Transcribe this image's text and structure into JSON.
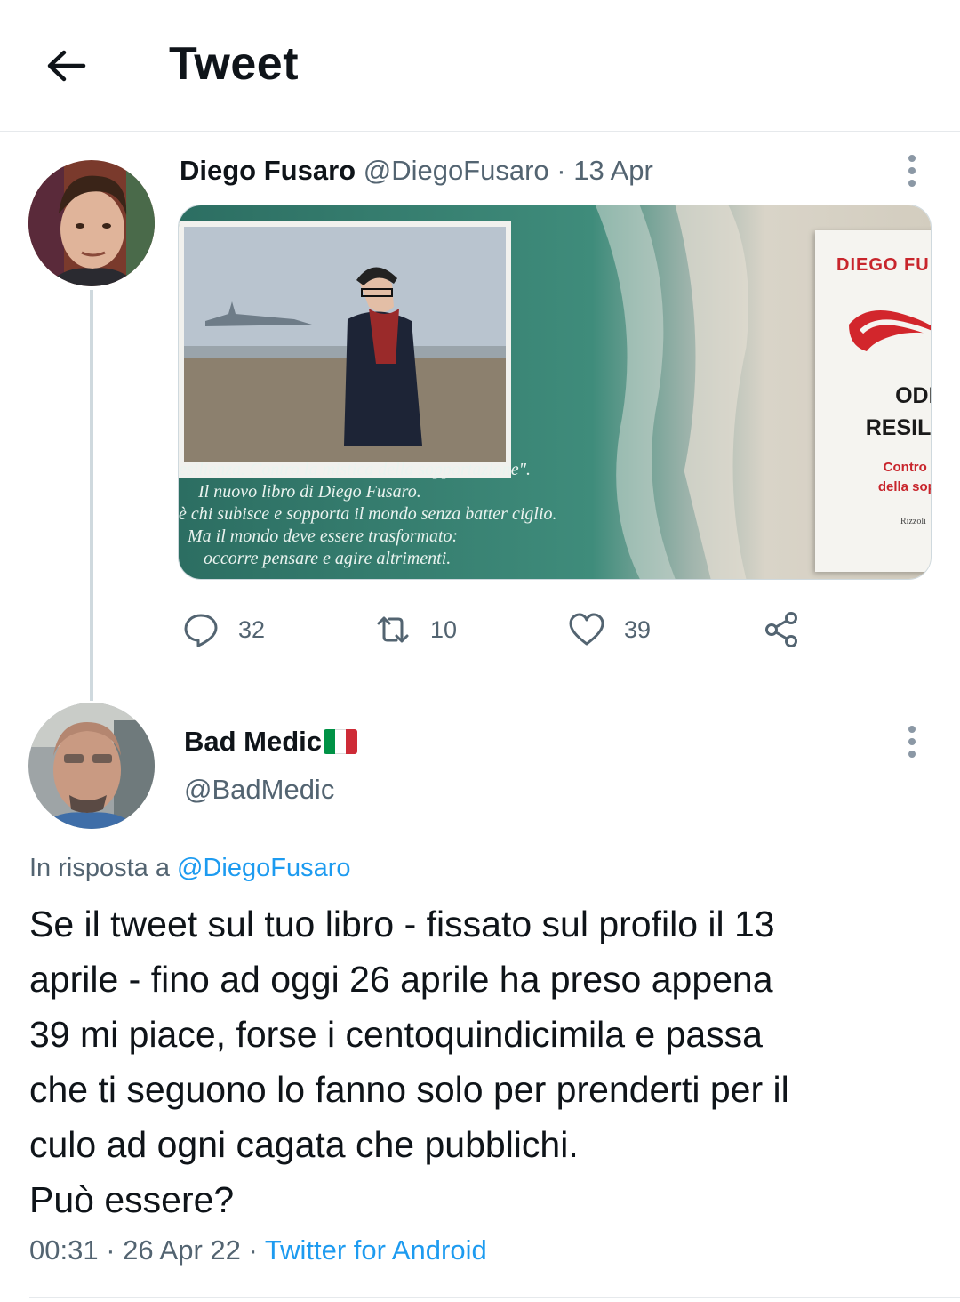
{
  "header": {
    "title": "Tweet",
    "back_icon": "arrow-left-icon"
  },
  "tweet1": {
    "name": "Diego Fusaro",
    "handle": "@DiegoFusaro",
    "dot": "·",
    "date": "13 Apr",
    "media": {
      "quote_lines": [
        "esilienza. Contro la mistica della sopportazione\".",
        "Il nuovo libro di Diego Fusaro.",
        "è chi subisce e sopporta il mondo senza batter ciglio.",
        "Ma il mondo deve essere trasformato:",
        "occorre pensare e agire altrimenti."
      ],
      "book_author": "DIEGO FU",
      "book_title_1": "ODIO",
      "book_title_2": "RESILIE",
      "book_sub_1": "Contro la m",
      "book_sub_2": "della soppor",
      "book_publisher": "Rizzoli"
    },
    "actions": {
      "replies": "32",
      "retweets": "10",
      "likes": "39"
    }
  },
  "tweet2": {
    "name": "Bad Medic",
    "flag_colors": [
      "#009246",
      "#ffffff",
      "#ce2b37"
    ],
    "handle": "@BadMedic",
    "reply_prefix": "In risposta a",
    "reply_handle": "@DiegoFusaro",
    "body_lines": [
      "Se il tweet sul tuo libro - fissato sul profilo il 13",
      "aprile - fino ad oggi 26 aprile ha preso appena",
      "39 mi piace, forse i centoquindicimila e passa",
      "che ti seguono lo fanno solo per prenderti per il",
      "culo ad ogni cagata che pubblichi.",
      "Può essere?"
    ],
    "time": "00:31",
    "date": "26 Apr 22",
    "source": "Twitter for Android"
  },
  "colors": {
    "accent": "#1d9bf0",
    "muted": "#536471",
    "text": "#0f1419"
  }
}
